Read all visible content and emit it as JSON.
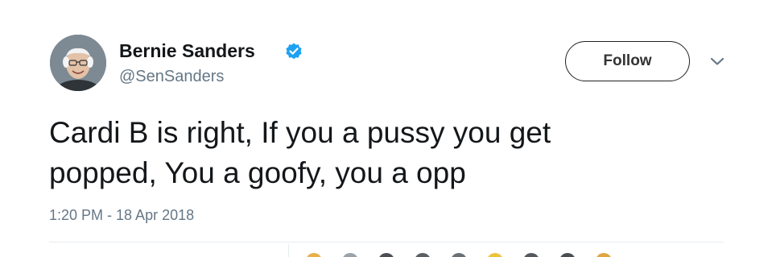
{
  "author": {
    "display_name": "Bernie Sanders",
    "handle": "@SenSanders",
    "verified_icon": "verified-badge-icon",
    "avatar_icon": "avatar-photo"
  },
  "actions": {
    "follow_label": "Follow",
    "menu_icon": "chevron-down-icon"
  },
  "tweet": {
    "text_line_1": "Cardi B is right, If you a pussy you get",
    "text_line_2": "popped, You a goofy, you a opp",
    "timestamp": "1:20 PM - 18 Apr 2018"
  },
  "colors": {
    "text": "#14171a",
    "secondary": "#657786",
    "verified": "#1da1f2",
    "divider": "#e6ecf0"
  }
}
